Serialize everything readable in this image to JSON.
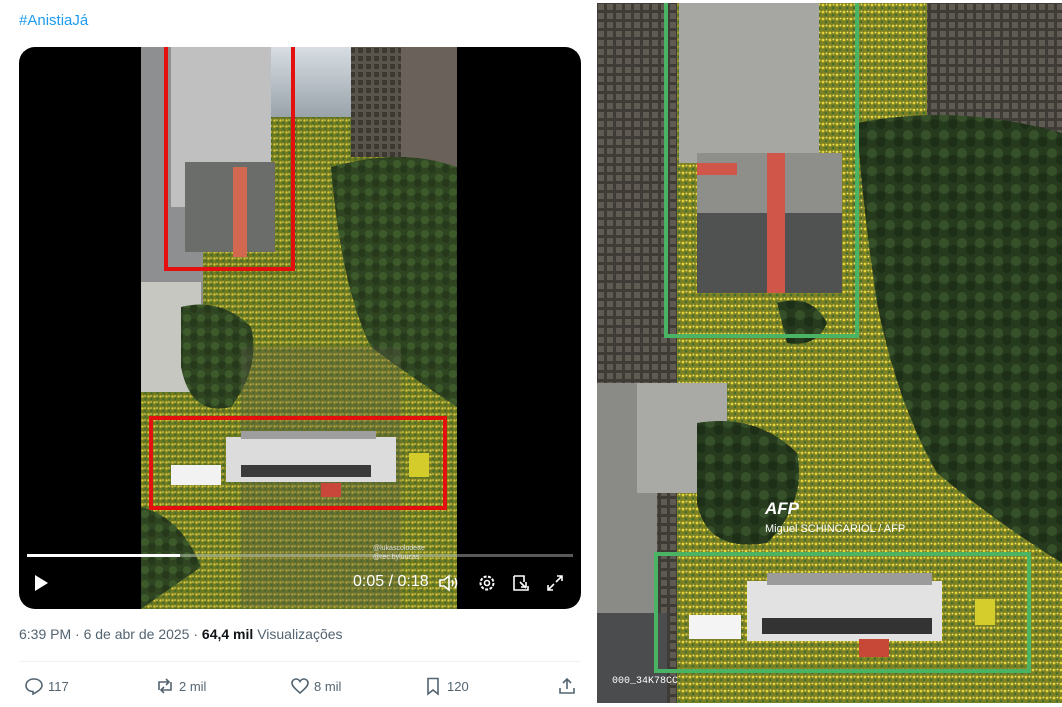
{
  "tweet": {
    "hashtag": "#AnistiaJá",
    "video": {
      "time": "0:05 / 0:18",
      "progress": 0.28,
      "watermark_line1": "@lukascolodette",
      "watermark_line2": "@rec.byluucas"
    },
    "meta": {
      "time": "6:39 PM",
      "date": "6 de abr de 2025",
      "views_count": "64,4 mil",
      "views_label": "Visualizações"
    },
    "actions": {
      "replies": "117",
      "reposts": "2 mil",
      "likes": "8 mil",
      "bookmarks": "120"
    }
  },
  "photo": {
    "agency_logo": "AFP",
    "credit": "Miguel SCHINCARIOL / AFP",
    "photo_id": "000_34K78CC"
  },
  "colors": {
    "link": "#1d9bf0",
    "red_box": "#e41010",
    "green_box": "#4bb464",
    "secondary_text": "#536471"
  }
}
